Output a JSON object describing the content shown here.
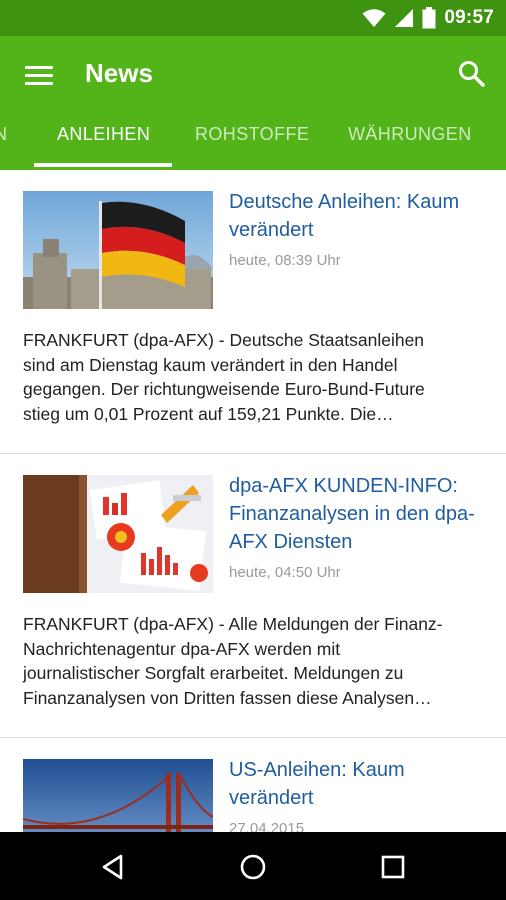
{
  "status_bar": {
    "time": "09:57",
    "icons": [
      "wifi-icon",
      "signal-icon",
      "battery-icon"
    ]
  },
  "app_bar": {
    "title": "News",
    "menu_icon": "menu-icon",
    "search_icon": "search-icon"
  },
  "tabs": [
    {
      "label": "N",
      "active": false
    },
    {
      "label": "ANLEIHEN",
      "active": true
    },
    {
      "label": "ROHSTOFFE",
      "active": false
    },
    {
      "label": "WÄHRUNGEN",
      "active": false
    }
  ],
  "articles": [
    {
      "title_lines": [
        "Deutsche Anleihen: Kaum",
        "verändert"
      ],
      "date": "heute, 08:39 Uhr",
      "summary_lines": [
        "FRANKFURT (dpa-AFX) - Deutsche Staatsanleihen",
        "sind am Dienstag kaum verändert in den Handel",
        "gegangen. Der richtungweisende Euro-Bund-Future",
        "stieg um 0,01 Prozent auf 159,21 Punkte. Die…"
      ]
    },
    {
      "title_lines": [
        "dpa-AFX KUNDEN-INFO:",
        "Finanzanalysen in den dpa-",
        "AFX Diensten"
      ],
      "date": "heute, 04:50 Uhr",
      "summary_lines": [
        "FRANKFURT (dpa-AFX) - Alle Meldungen der Finanz-",
        "Nachrichtenagentur dpa-AFX werden mit",
        "journalistischer Sorgfalt erarbeitet. Meldungen zu",
        "Finanzanalysen von Dritten fassen diese Analysen…"
      ]
    },
    {
      "title_lines": [
        "US-Anleihen: Kaum",
        "verändert"
      ],
      "date": "27.04.2015",
      "summary_lines": []
    }
  ],
  "nav_bar": {
    "icons": [
      "back-icon",
      "home-icon",
      "recents-icon"
    ]
  },
  "colors": {
    "status_bar": "#3e9410",
    "app_bar": "#53b41a",
    "headline": "#1f5da0",
    "date": "#9a9a9a"
  }
}
